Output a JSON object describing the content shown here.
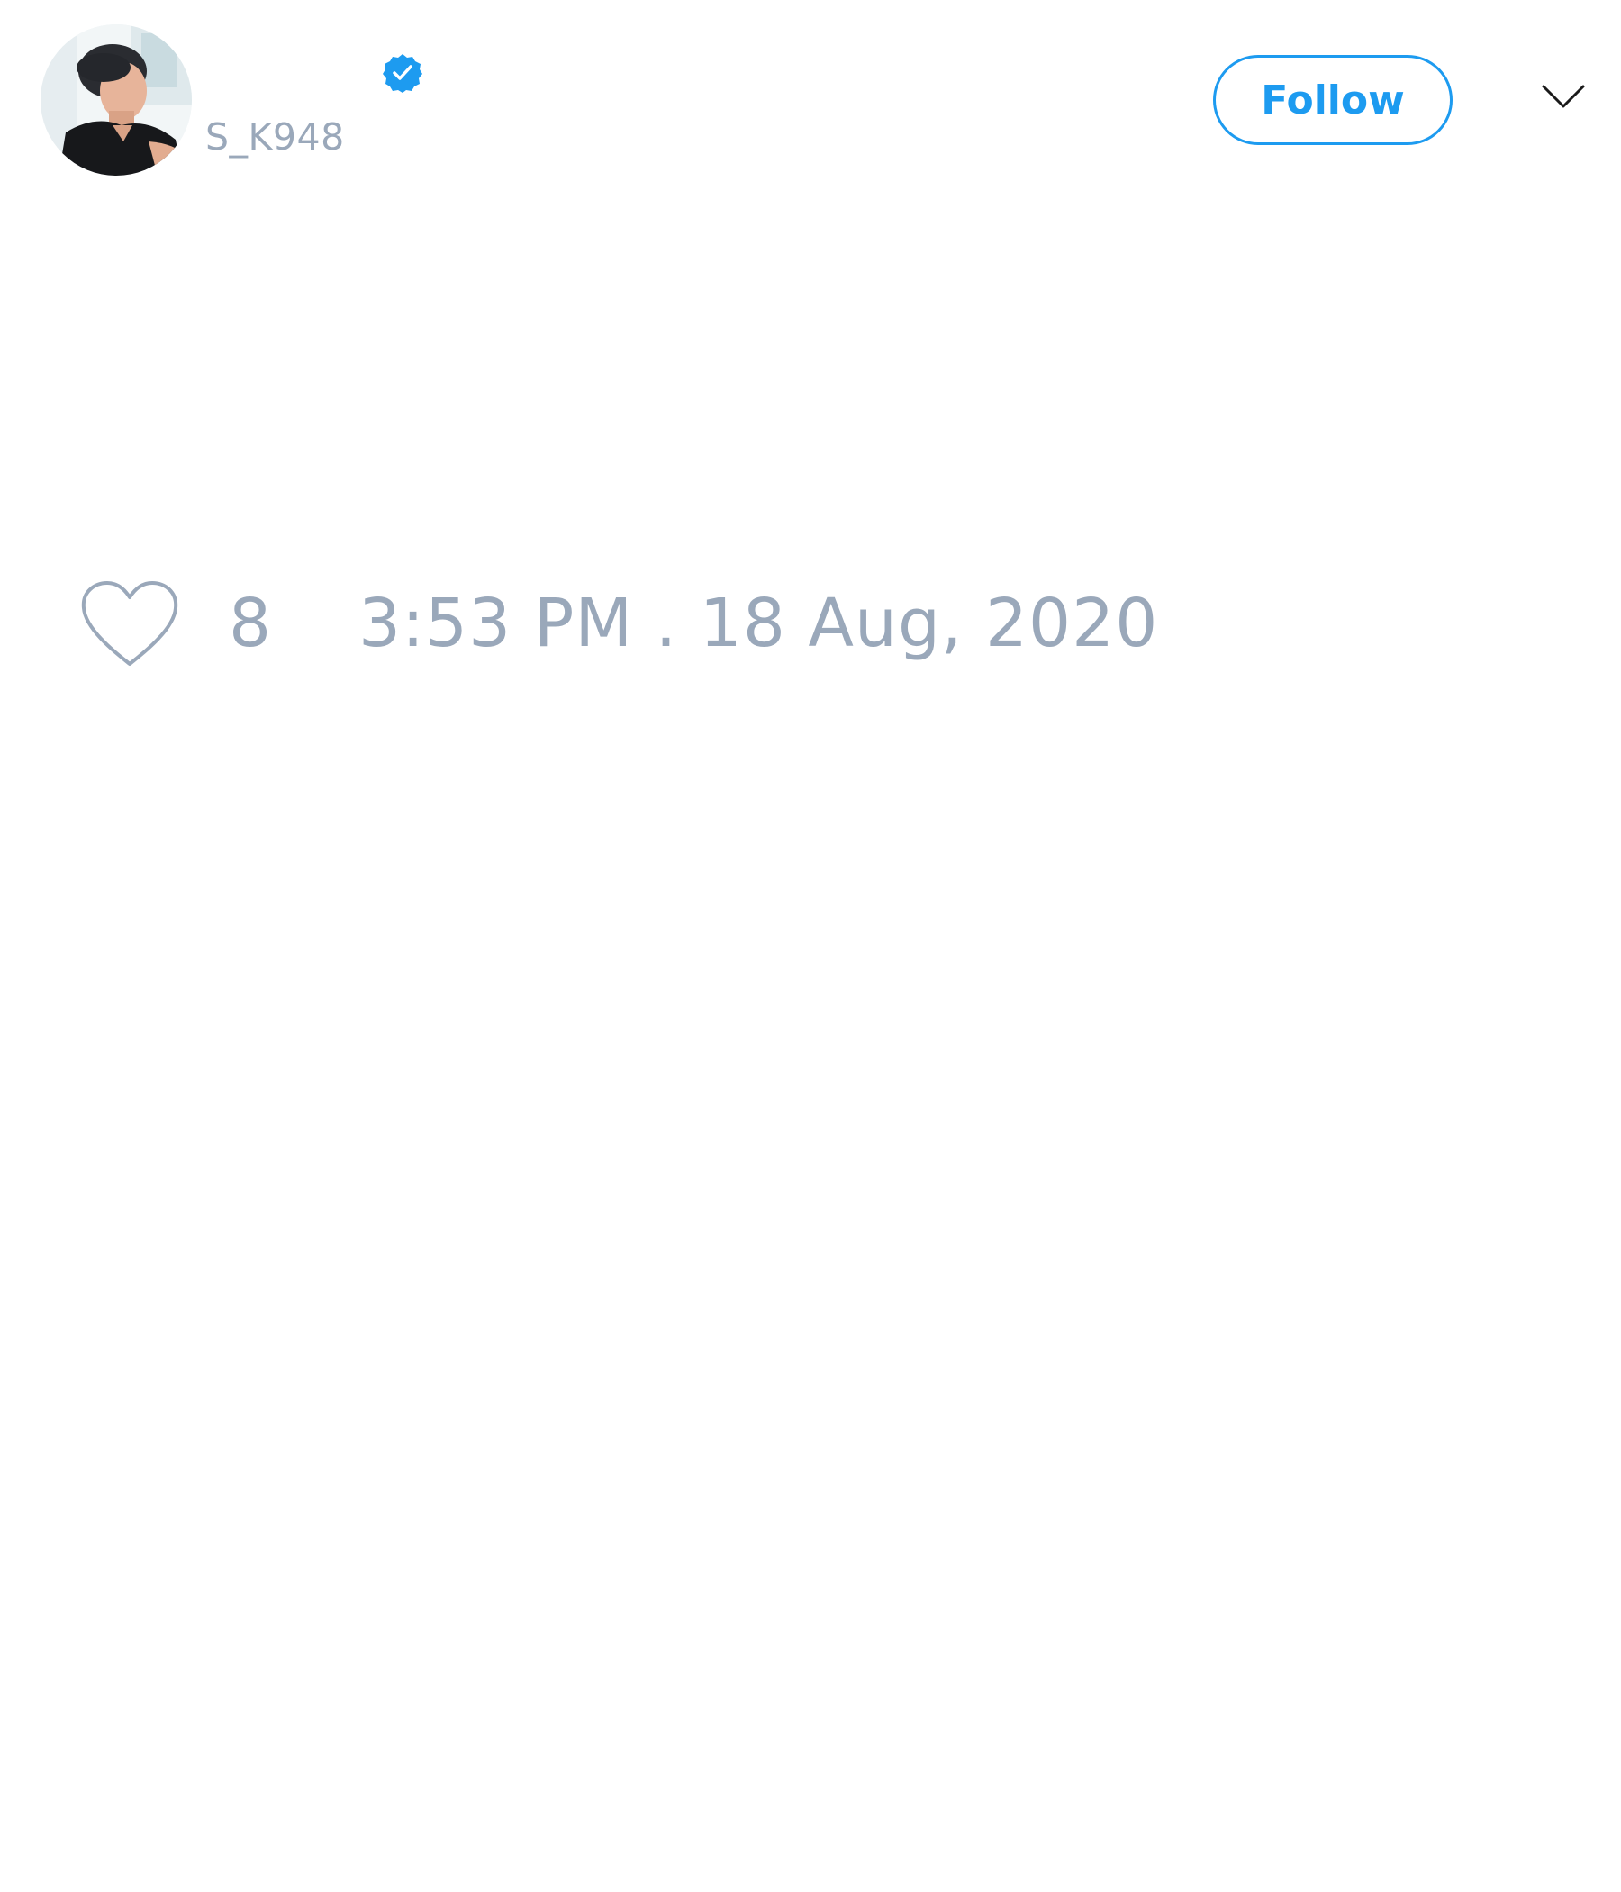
{
  "tweet": {
    "author": {
      "handle": "S_K948",
      "verified": true,
      "avatar_icon": "user-avatar-photo"
    },
    "follow_button": {
      "label": "Follow"
    },
    "menu_icon": "chevron-down-icon",
    "likes": {
      "icon": "heart-icon",
      "count": "8"
    },
    "timestamp": "3:53 PM . 18 Aug, 2020"
  },
  "colors": {
    "accent": "#1d9bf0",
    "muted_text": "#9aa8ba",
    "background": "#ffffff"
  }
}
